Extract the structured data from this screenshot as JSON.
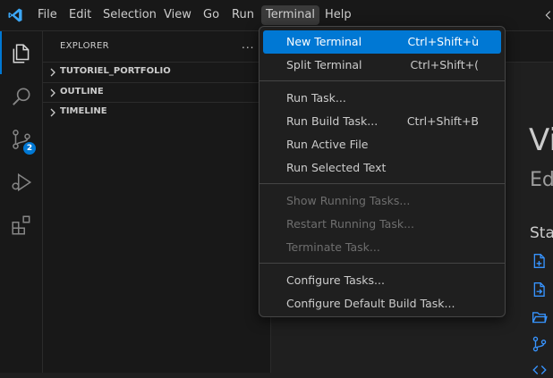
{
  "menubar": {
    "items": [
      {
        "label": "File"
      },
      {
        "label": "Edit"
      },
      {
        "label": "Selection"
      },
      {
        "label": "View"
      },
      {
        "label": "Go"
      },
      {
        "label": "Run"
      },
      {
        "label": "Terminal",
        "active": true
      },
      {
        "label": "Help"
      }
    ]
  },
  "activity": {
    "source_control_badge": "2",
    "icons": [
      "explorer-icon",
      "search-icon",
      "source-control-icon",
      "run-debug-icon",
      "extensions-icon"
    ]
  },
  "sidebar": {
    "title": "EXPLORER",
    "more": "...",
    "sections": [
      {
        "label": "TUTORIEL_PORTFOLIO"
      },
      {
        "label": "OUTLINE"
      },
      {
        "label": "TIMELINE"
      }
    ]
  },
  "welcome": {
    "title": "Vi",
    "subtitle": "Ed",
    "start": "Sta"
  },
  "terminal_menu": {
    "groups": [
      [
        {
          "label": "New Terminal",
          "shortcut": "Ctrl+Shift+ù",
          "highlighted": true
        },
        {
          "label": "Split Terminal",
          "shortcut": "Ctrl+Shift+("
        }
      ],
      [
        {
          "label": "Run Task...",
          "shortcut": ""
        },
        {
          "label": "Run Build Task...",
          "shortcut": "Ctrl+Shift+B"
        },
        {
          "label": "Run Active File",
          "shortcut": ""
        },
        {
          "label": "Run Selected Text",
          "shortcut": ""
        }
      ],
      [
        {
          "label": "Show Running Tasks...",
          "shortcut": "",
          "disabled": true
        },
        {
          "label": "Restart Running Task...",
          "shortcut": "",
          "disabled": true
        },
        {
          "label": "Terminate Task...",
          "shortcut": "",
          "disabled": true
        }
      ],
      [
        {
          "label": "Configure Tasks...",
          "shortcut": ""
        },
        {
          "label": "Configure Default Build Task...",
          "shortcut": ""
        }
      ]
    ]
  },
  "colors": {
    "accent": "#0078d4",
    "background": "#1f1f1f",
    "chrome": "#181818"
  }
}
